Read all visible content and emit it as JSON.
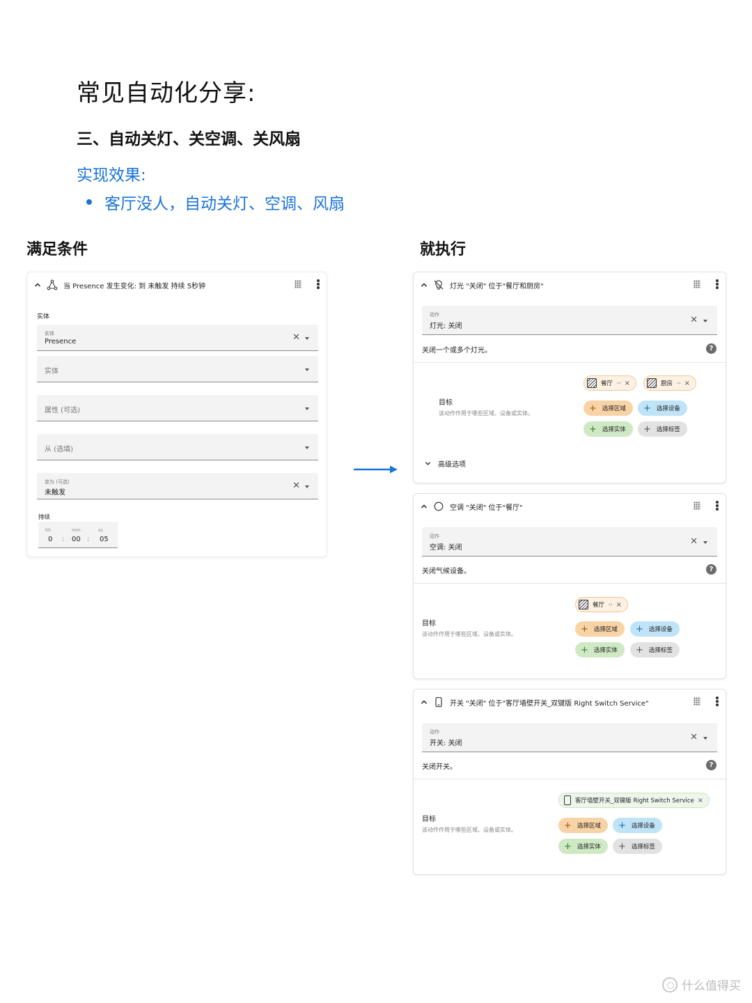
{
  "page_title": "常见自动化分享:",
  "section_title": "三、自动关灯、关空调、关风扇",
  "effect": {
    "label": "实现效果:",
    "items": [
      "客厅没人，自动关灯、空调、风扇"
    ]
  },
  "colors": {
    "accent": "#1a73d9",
    "arrow": "#1a73d9"
  },
  "left_column": {
    "title": "满足条件",
    "trigger_card": {
      "header": "当 Presence 发生变化:  到 未触发 持续 5秒钟",
      "header_icon": "state-trigger-icon",
      "section_label": "实体",
      "entity_field": {
        "label": "实体",
        "value": "Presence"
      },
      "entity_field2": {
        "placeholder": "实体"
      },
      "attribute_field": {
        "placeholder": "属性 (可选)"
      },
      "from_field": {
        "placeholder": "从 (选填)"
      },
      "to_field": {
        "label": "变为 (可选)",
        "value": "未触发"
      },
      "duration": {
        "label": "持续",
        "hh_label": "hh",
        "mm_label": "mm",
        "ss_label": "ss",
        "hh": "0",
        "mm": "00",
        "ss": "05",
        "separator": ":"
      }
    }
  },
  "right_column": {
    "title": "就执行",
    "actions": [
      {
        "header": "灯光 \"关闭\" 位于\"餐厅和厨房\"",
        "header_icon": "lightbulb-off-icon",
        "action_label": "动作",
        "action_value": "灯光: 关闭",
        "description": "关闭一个或多个灯光。",
        "target_label": "目标",
        "target_sub": "该动作作用于哪些区域、设备或实体。",
        "chips": [
          {
            "label": "餐厅",
            "mid": "‹›"
          },
          {
            "label": "厨房",
            "mid": "‹›"
          }
        ],
        "pills": {
          "area": "选择区域",
          "device": "选择设备",
          "entity": "选择实体",
          "label": "选择标签"
        },
        "advanced": "高级选项"
      },
      {
        "header": "空调 \"关闭\" 位于\"餐厅\"",
        "header_icon": "circle-outline-icon",
        "action_label": "动作",
        "action_value": "空调: 关闭",
        "description": "关闭气候设备。",
        "target_label": "目标",
        "target_sub": "该动作作用于哪些区域、设备或实体。",
        "chips": [
          {
            "label": "餐厅",
            "mid": "‹›"
          }
        ],
        "pills": {
          "area": "选择区域",
          "device": "选择设备",
          "entity": "选择实体",
          "label": "选择标签"
        }
      },
      {
        "header": "开关 \"关闭\" 位于\"客厅墙壁开关_双键版 Right Switch Service\"",
        "header_icon": "switch-device-icon",
        "action_label": "动作",
        "action_value": "开关: 关闭",
        "description": "关闭开关。",
        "target_label": "目标",
        "target_sub": "该动作作用于哪些区域、设备或实体。",
        "chips": [
          {
            "label": "客厅墙壁开关_双键版 Right Switch Service"
          }
        ],
        "pills": {
          "area": "选择区域",
          "device": "选择设备",
          "entity": "选择实体",
          "label": "选择标签"
        }
      }
    ]
  },
  "watermark": "什么值得买"
}
